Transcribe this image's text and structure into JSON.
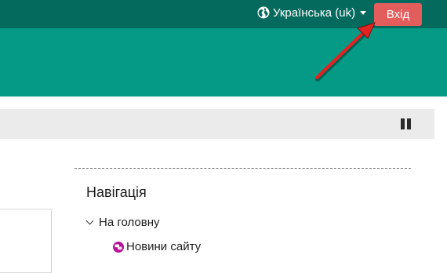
{
  "header": {
    "language_label": "Українська (uk)",
    "login_label": "Вхід"
  },
  "navigation": {
    "title": "Навігація",
    "home_label": "На головну",
    "news_label": "Новини сайту"
  },
  "colors": {
    "topbar": "#056a5e",
    "hero": "#049a85",
    "login_button": "#e45d5d",
    "annotation_arrow": "#e32222",
    "forum_icon": "#b4119a"
  }
}
